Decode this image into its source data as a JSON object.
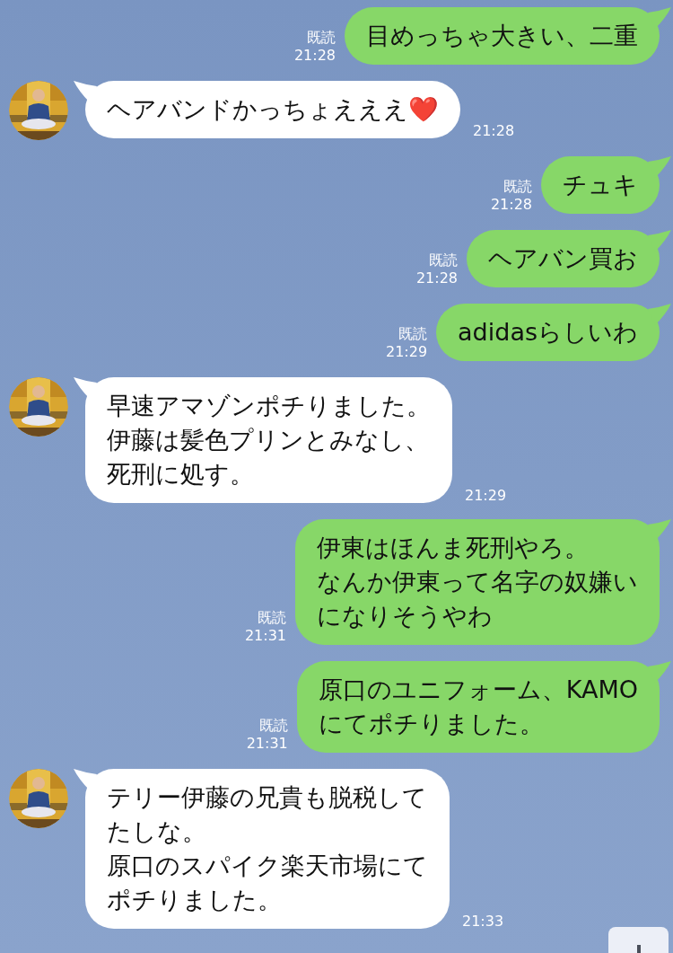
{
  "messages": [
    {
      "kind": "sent",
      "lines": [
        "目めっちゃ大きい、二重"
      ],
      "read": "既読",
      "time": "21:28"
    },
    {
      "kind": "received",
      "avatar": {
        "kind": "picture"
      },
      "lines": [
        "ヘアバンドかっちょえええ❤️"
      ],
      "time": "21:28"
    },
    {
      "kind": "sent",
      "lines": [
        "チュキ"
      ],
      "read": "既読",
      "time": "21:28"
    },
    {
      "kind": "sent",
      "lines": [
        "ヘアバン買お"
      ],
      "read": "既読",
      "time": "21:28"
    },
    {
      "kind": "sent",
      "lines": [
        "adidasらしいわ"
      ],
      "read": "既読",
      "time": "21:29"
    },
    {
      "kind": "received",
      "avatar": {
        "kind": "picture"
      },
      "lines": [
        "早速アマゾンポチりました。",
        "伊藤は髪色プリンとみなし、",
        "死刑に処す。"
      ],
      "time": "21:29"
    },
    {
      "kind": "sent",
      "lines": [
        "伊東はほんま死刑やろ。",
        "なんか伊東って名字の奴嫌い",
        "になりそうやわ"
      ],
      "read": "既読",
      "time": "21:31"
    },
    {
      "kind": "sent",
      "lines": [
        "原口のユニフォーム、KAMO",
        "にてポチりました。"
      ],
      "read": "既読",
      "time": "21:31"
    },
    {
      "kind": "received",
      "avatar": {
        "kind": "picture"
      },
      "lines": [
        "テリー伊藤の兄貴も脱税して",
        "たしな。",
        "原口のスパイク楽天市場にて",
        "ポチりました。"
      ],
      "time": "21:33"
    }
  ]
}
